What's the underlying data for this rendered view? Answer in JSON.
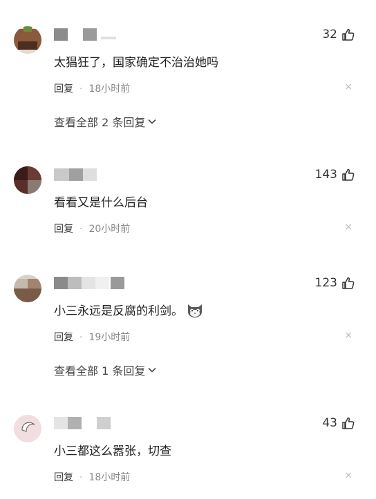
{
  "comments": [
    {
      "likes": "32",
      "text": "太猖狂了，国家确定不治治她吗",
      "reply": "回复",
      "time": "18小时前",
      "close": "×",
      "expand": "查看全部 2 条回复",
      "avatar_color": "#8a5a3c"
    },
    {
      "likes": "143",
      "text": "看看又是什么后台",
      "reply": "回复",
      "time": "20小时前",
      "close": "×",
      "avatar_color": "#5a2e2a"
    },
    {
      "likes": "123",
      "text": "小三永远是反腐的利剑。",
      "reply": "回复",
      "time": "19小时前",
      "close": "×",
      "expand": "查看全部 1 条回复",
      "avatar_color": "#7a5a48"
    },
    {
      "likes": "43",
      "text": "小三都这么嚣张，切查",
      "reply": "回复",
      "time": "18小时前",
      "close": "×",
      "avatar_color": "#f2dde0"
    }
  ],
  "icons": {
    "like": "thumbs-up-icon",
    "expand": "chevron-down-icon",
    "emoji": "cat-face-emoji-icon"
  }
}
